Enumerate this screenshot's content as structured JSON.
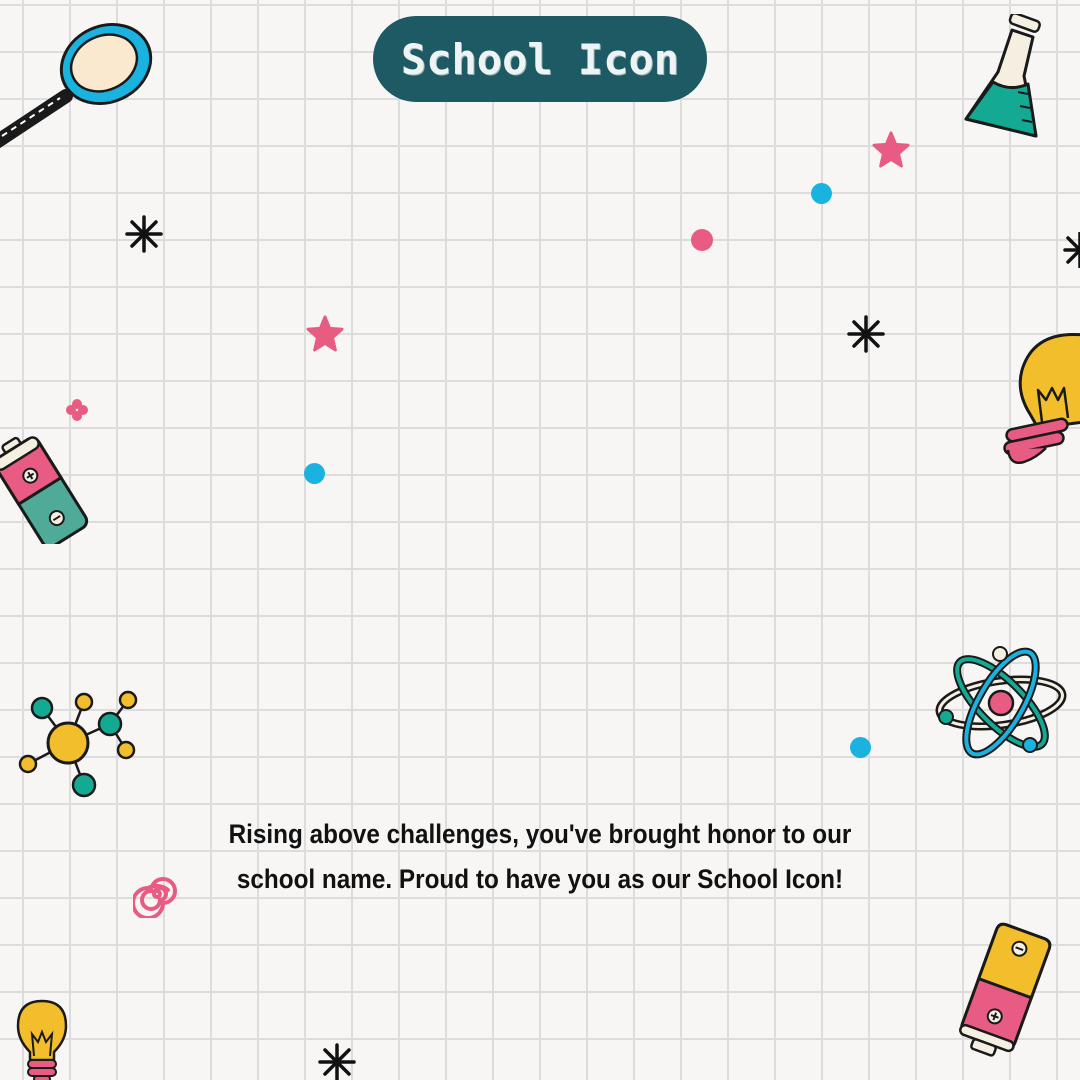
{
  "title": "School Icon",
  "message": "Rising above challenges, you've brought honor to our school name. Proud to have you as our School Icon!",
  "colors": {
    "pill": "#1d5a64",
    "teal": "#13a992",
    "pink": "#e85c83",
    "blue": "#1ab3e0",
    "yellow": "#f2be2c",
    "dark": "#1a1a1a"
  },
  "icons": [
    "magnifying-glass-icon",
    "flask-icon",
    "lightbulb-icon",
    "battery-icon",
    "molecule-icon",
    "atom-icon",
    "spiral-icon",
    "star-icon",
    "asterisk-icon",
    "dot-icon"
  ]
}
